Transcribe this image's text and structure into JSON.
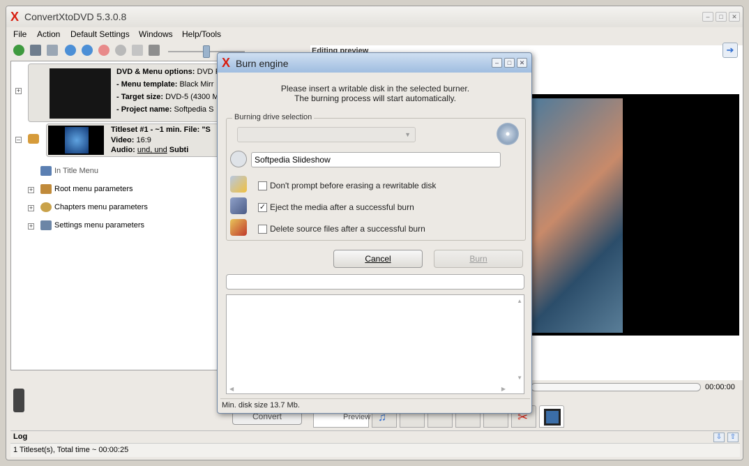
{
  "app": {
    "title": "ConvertXtoDVD 5.3.0.8",
    "logo_glyph": "X",
    "menu": [
      "File",
      "Action",
      "Default Settings",
      "Windows",
      "Help/Tools"
    ]
  },
  "project": {
    "dvd_menu_label": "DVD & Menu options:",
    "dvd_menu_value": "DVD P",
    "menu_template_label": "- Menu template:",
    "menu_template_value": "Black Mirr",
    "target_size_label": "- Target size:",
    "target_size_value": "DVD-5 (4300 M",
    "project_name_label": "- Project name:",
    "project_name_value": "Softpedia S",
    "titleset_label": "Titleset #1 - ~1 min. File: \"S",
    "video_label": "Video:",
    "video_value": "16:9",
    "audio_label": "Audio:",
    "audio_value": "und, und",
    "subtitle_label": "Subti"
  },
  "tree": {
    "in_title_menu": "In Title Menu",
    "root_menu": "Root menu parameters",
    "chapters_menu": "Chapters menu parameters",
    "settings_menu": "Settings menu parameters"
  },
  "preview": {
    "editing_label": "Editing preview",
    "time": "00:00:00",
    "preview_tab": "Preview",
    "convert_button": "Convert"
  },
  "log": {
    "label": "Log",
    "status": "1 Titleset(s), Total time ~ 00:00:25"
  },
  "dialog": {
    "title": "Burn engine",
    "message_line1": "Please insert a writable disk in the selected burner.",
    "message_line2": "The burning process will start automatically.",
    "group_label": "Burning drive selection",
    "disc_name": "Softpedia Slideshow",
    "options": [
      {
        "label": "Don't prompt before erasing a rewritable disk",
        "checked": false
      },
      {
        "label": "Eject the media after a successful burn",
        "checked": true
      },
      {
        "label": "Delete source files after a successful burn",
        "checked": false
      }
    ],
    "cancel_button": "Cancel",
    "burn_button": "Burn",
    "status": "Min. disk size 13.7 Mb."
  }
}
